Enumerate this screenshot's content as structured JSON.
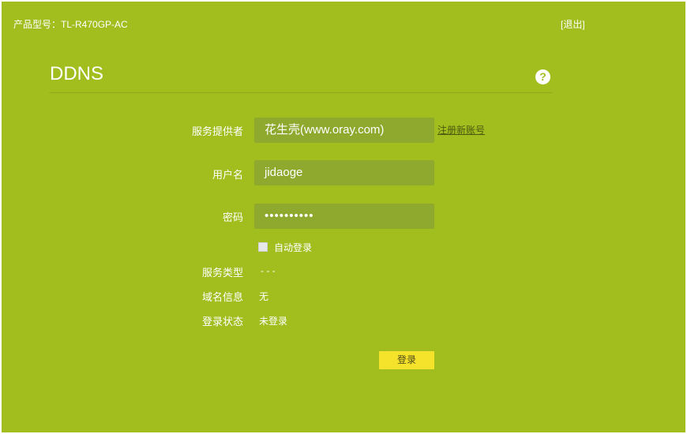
{
  "header": {
    "model_label": "产品型号：TL-R470GP-AC",
    "logout_label": "[退出]"
  },
  "page": {
    "title": "DDNS",
    "help_icon_glyph": "?"
  },
  "form": {
    "provider_label": "服务提供者",
    "provider_value": "花生壳(www.oray.com)",
    "register_link": "注册新账号",
    "username_label": "用户名",
    "username_value": "jidaoge",
    "password_label": "密码",
    "password_value": "••••••••••",
    "auto_login_label": "自动登录",
    "auto_login_checked": false,
    "service_type_label": "服务类型",
    "service_type_value": "- - -",
    "domain_info_label": "域名信息",
    "domain_info_value": "无",
    "login_status_label": "登录状态",
    "login_status_value": "未登录",
    "login_button": "登录"
  },
  "colors": {
    "background": "#a1bd1e",
    "field_background": "#8fa82e",
    "button": "#f5e22a"
  }
}
